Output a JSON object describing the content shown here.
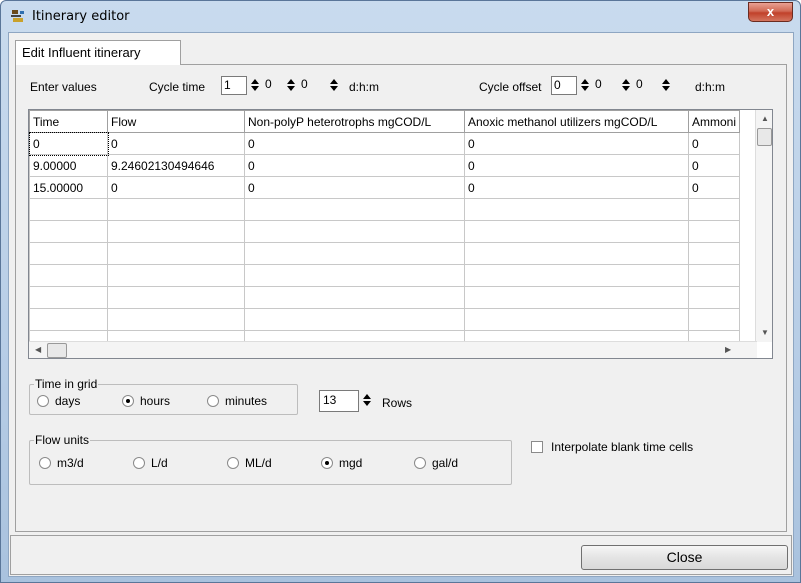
{
  "window": {
    "title": "Itinerary editor",
    "close_glyph": "x",
    "icon": "app-icon"
  },
  "tab": {
    "label": "Edit Influent itinerary"
  },
  "enter_values_label": "Enter values",
  "cycle_time": {
    "label": "Cycle time",
    "values": [
      "1",
      "0",
      "0"
    ],
    "unit": "d:h:m"
  },
  "cycle_offset": {
    "label": "Cycle offset",
    "values": [
      "0",
      "0",
      "0"
    ],
    "unit": "d:h:m"
  },
  "grid": {
    "columns": [
      "Time",
      "Flow",
      "Non-polyP heterotrophs mgCOD/L",
      "Anoxic methanol utilizers mgCOD/L",
      "Ammoni"
    ],
    "rows": [
      [
        "0",
        "0",
        "0",
        "0",
        "0"
      ],
      [
        "9.00000",
        "9.24602130494646",
        "0",
        "0",
        "0"
      ],
      [
        "15.00000",
        "0",
        "0",
        "0",
        "0"
      ],
      [
        "",
        "",
        "",
        "",
        ""
      ],
      [
        "",
        "",
        "",
        "",
        ""
      ],
      [
        "",
        "",
        "",
        "",
        ""
      ],
      [
        "",
        "",
        "",
        "",
        ""
      ],
      [
        "",
        "",
        "",
        "",
        ""
      ],
      [
        "",
        "",
        "",
        "",
        ""
      ],
      [
        "",
        "",
        "",
        "",
        ""
      ]
    ]
  },
  "time_in_grid": {
    "title": "Time in grid",
    "options": [
      {
        "label": "days",
        "selected": false
      },
      {
        "label": "hours",
        "selected": true
      },
      {
        "label": "minutes",
        "selected": false
      }
    ]
  },
  "rows_spinner": {
    "value": "13",
    "label": "Rows"
  },
  "flow_units": {
    "title": "Flow units",
    "options": [
      {
        "label": "m3/d",
        "selected": false
      },
      {
        "label": "L/d",
        "selected": false
      },
      {
        "label": "ML/d",
        "selected": false
      },
      {
        "label": "mgd",
        "selected": true
      },
      {
        "label": "gal/d",
        "selected": false
      }
    ]
  },
  "interpolate_checkbox": {
    "label": "Interpolate blank time cells",
    "checked": false
  },
  "close_button": {
    "label": "Close"
  },
  "colors": {
    "title_close": "#c1412a",
    "frame": "#b7cde6",
    "panel": "#f0f0f0"
  }
}
